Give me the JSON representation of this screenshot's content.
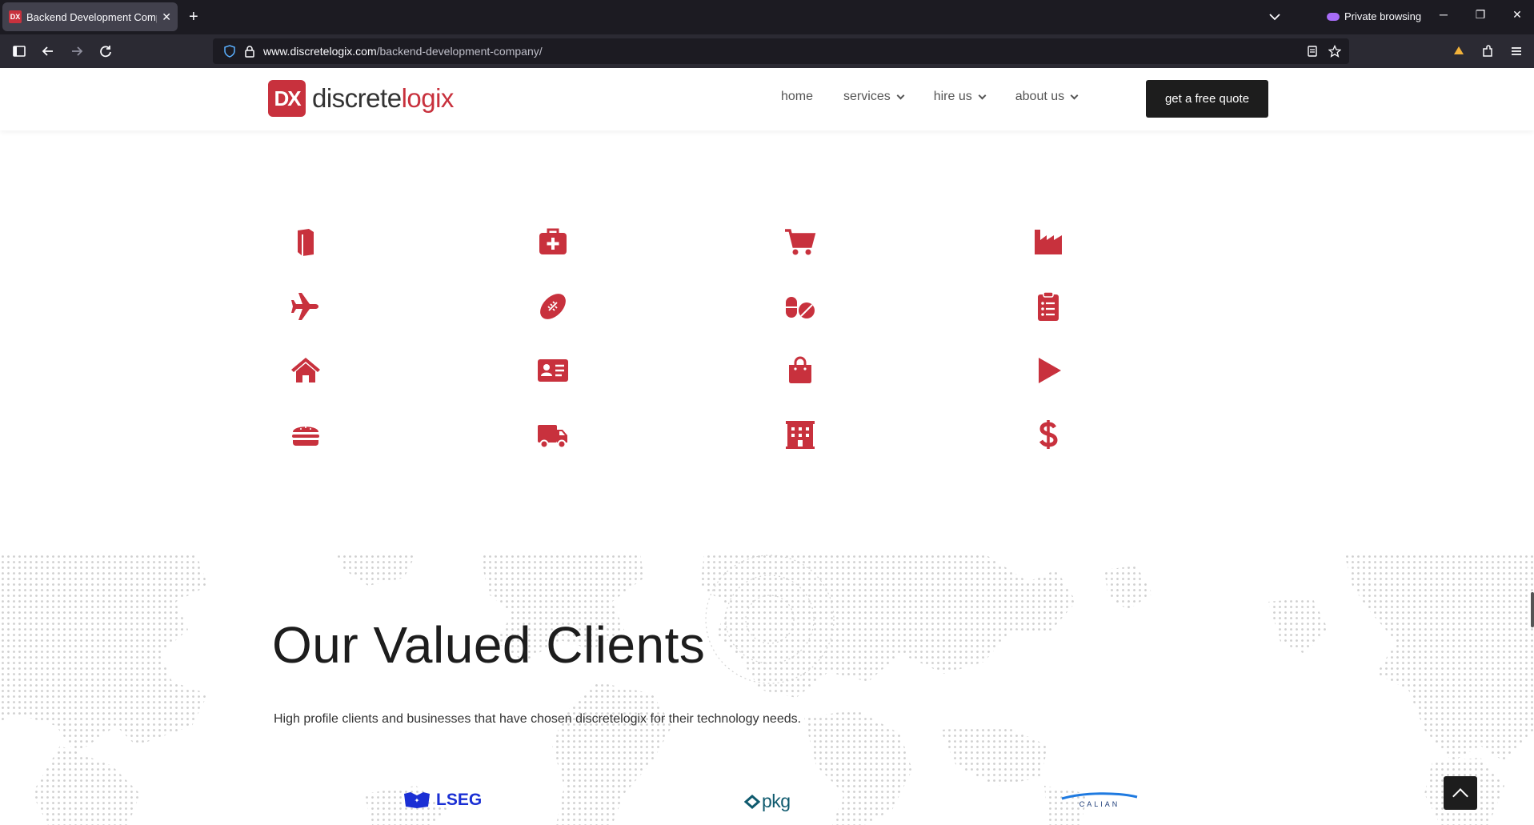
{
  "browser": {
    "tab_title": "Backend Development Company",
    "tab_favicon": "DX",
    "new_tab": "+",
    "tab_close": "✕",
    "private_label": "Private browsing",
    "url_host": "www.discretelogix.com",
    "url_path": "/backend-development-company/"
  },
  "header": {
    "logo_mark": "DX",
    "logo_word_a": "discrete",
    "logo_word_b": "logix",
    "menu": [
      {
        "label": "home"
      },
      {
        "label": "services"
      },
      {
        "label": "hire us"
      },
      {
        "label": "about us"
      }
    ],
    "cta": "get a free quote"
  },
  "industries": {
    "color": "#c8313d",
    "icons": [
      "book-icon",
      "medical-kit-icon",
      "cart-icon",
      "factory-icon",
      "plane-icon",
      "football-icon",
      "pills-icon",
      "clipboard-list-icon",
      "home-icon",
      "id-card-icon",
      "shopping-bag-icon",
      "play-icon",
      "burger-icon",
      "truck-icon",
      "building-icon",
      "dollar-icon"
    ]
  },
  "clients": {
    "title": "Our Valued Clients",
    "subtitle": "High profile clients and businesses that have chosen discretelogix for their technology needs.",
    "logos": [
      {
        "name": "LSEG",
        "color": "#1a2fd4"
      },
      {
        "name": "pkg",
        "color": "#0f5a6e"
      },
      {
        "name": "CALIAN",
        "color": "#1f3e7a"
      }
    ]
  },
  "colors": {
    "accent": "#c8313d",
    "dark": "#1d1d1d"
  }
}
